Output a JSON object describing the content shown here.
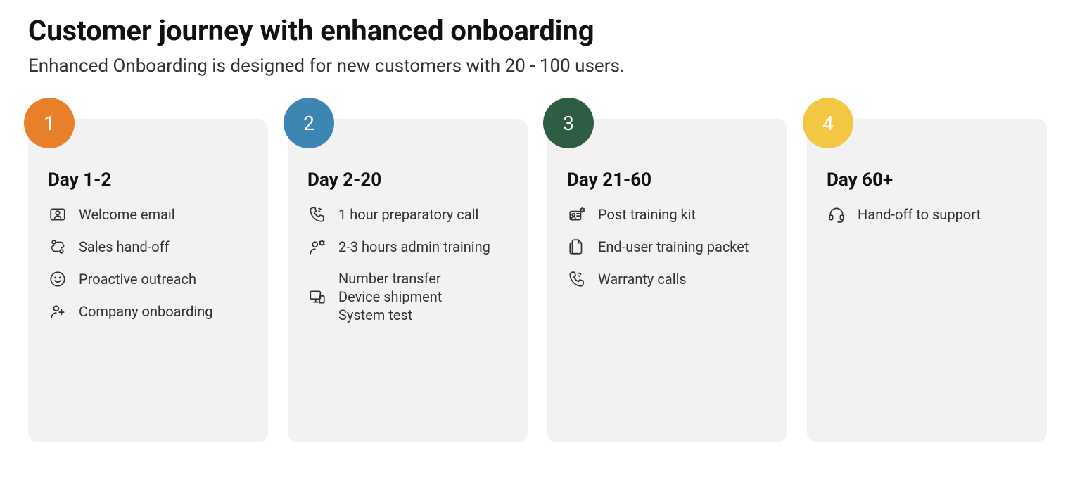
{
  "title": "Customer journey with enhanced onboarding",
  "subtitle": "Enhanced Onboarding is designed for new customers with 20 - 100 users.",
  "colors": {
    "badge1": "#e77f2b",
    "badge2": "#3d86b4",
    "badge3": "#2f5d44",
    "badge4": "#f3c743"
  },
  "stages": [
    {
      "num": "1",
      "heading": "Day 1-2",
      "items": [
        {
          "icon": "id-card-icon",
          "label": "Welcome email"
        },
        {
          "icon": "handoff-icon",
          "label": "Sales hand-off"
        },
        {
          "icon": "smile-icon",
          "label": "Proactive outreach"
        },
        {
          "icon": "user-plus-icon",
          "label": "Company onboarding"
        }
      ]
    },
    {
      "num": "2",
      "heading": "Day 2-20",
      "items": [
        {
          "icon": "phone-icon",
          "label": "1 hour preparatory call"
        },
        {
          "icon": "user-gear-icon",
          "label": "2-3 hours admin training"
        },
        {
          "icon": "devices-icon",
          "label": "Number transfer",
          "label2": "Device shipment",
          "label3": "System test"
        }
      ]
    },
    {
      "num": "3",
      "heading": "Day 21-60",
      "items": [
        {
          "icon": "kit-icon",
          "label": "Post training kit"
        },
        {
          "icon": "document-icon",
          "label": "End-user training packet"
        },
        {
          "icon": "phone-icon",
          "label": "Warranty calls"
        }
      ]
    },
    {
      "num": "4",
      "heading": "Day 60+",
      "items": [
        {
          "icon": "headset-icon",
          "label": "Hand-off to support"
        }
      ]
    }
  ]
}
